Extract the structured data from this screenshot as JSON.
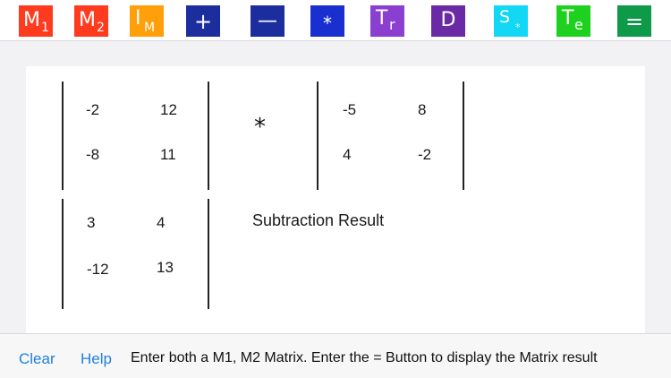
{
  "colors": {
    "m1": "#ff3b1f",
    "m2": "#ff3b1f",
    "im": "#ff9f0a",
    "add": "#1c2d9e",
    "subtract": "#1c2d9e",
    "multiply": "#1a2fd0",
    "transpose": "#8a3fd1",
    "determinant": "#6a2aa5",
    "scalar": "#12d7f5",
    "te": "#1fd11f",
    "equals": "#0f9a49",
    "link": "#1e7fe0"
  },
  "toolbar": {
    "m1": {
      "main": "M",
      "sub": "1"
    },
    "m2": {
      "main": "M",
      "sub": "2"
    },
    "im": {
      "main": "I",
      "sub": "M"
    },
    "add": "+",
    "subtract": "—",
    "multiply": "*",
    "transpose": {
      "main": "T",
      "sub": "r"
    },
    "determinant": "D",
    "scalar": {
      "main": "S",
      "sub": "*"
    },
    "te": {
      "main": "T",
      "sub": "e"
    },
    "equals": "="
  },
  "matrix1": [
    [
      "-2",
      "12"
    ],
    [
      "-8",
      "11"
    ]
  ],
  "operator": "*",
  "matrix2": [
    [
      "-5",
      "8"
    ],
    [
      "4",
      "-2"
    ]
  ],
  "result": [
    [
      "3",
      "4"
    ],
    [
      "-12",
      "13"
    ]
  ],
  "result_label": "Subtraction Result",
  "footer": {
    "clear": "Clear",
    "help": "Help",
    "hint": "Enter both a M1, M2 Matrix.  Enter the = Button to display the Matrix result"
  }
}
